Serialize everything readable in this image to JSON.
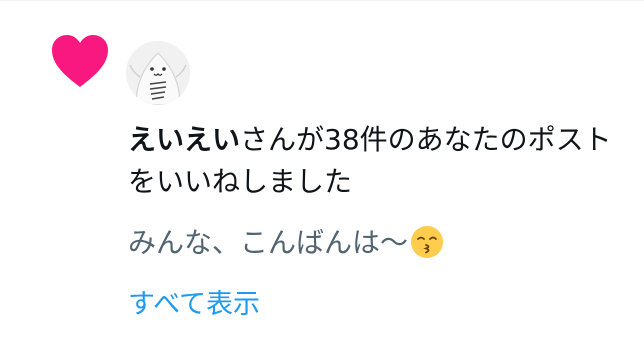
{
  "notification": {
    "icon": "heart-icon",
    "icon_color": "#f91880",
    "avatar": "ghost-mascot-avatar",
    "user_name": "えいえい",
    "message_tail": "さんが38件のあなたのポストをいいねしました",
    "post_preview": "みんな、こんばんは〜",
    "preview_emoji": "kissing-face-emoji",
    "show_all_label": "すべて表示",
    "link_color": "#1d9bf0"
  }
}
